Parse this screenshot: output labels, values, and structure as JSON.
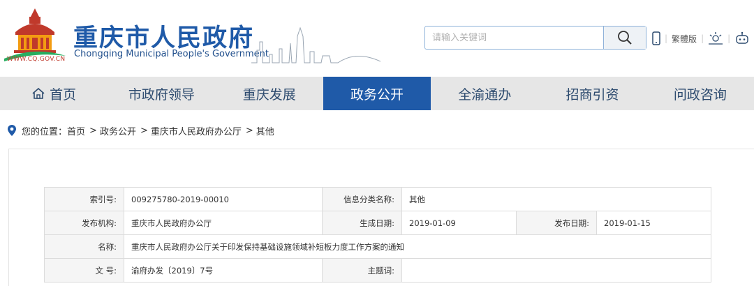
{
  "header": {
    "site_title": "重庆市人民政府",
    "site_subtitle": "Chongqing Municipal People's Government",
    "site_url": "WWW.CQ.GOV.CN",
    "search": {
      "placeholder": "请输入关键词",
      "icon": "search-icon"
    },
    "tools": {
      "traditional": "繁體版",
      "mobile_icon": "mobile-icon",
      "elder_icon": "elder-mode-icon",
      "robot_icon": "robot-icon"
    },
    "colors": {
      "brand_blue": "#1f5aa8",
      "logo_red": "#c0392b",
      "logo_orange": "#f39c12",
      "logo_green": "#27ae60"
    }
  },
  "nav": {
    "items": [
      {
        "label": "首页",
        "active": false
      },
      {
        "label": "市政府领导",
        "active": false
      },
      {
        "label": "重庆发展",
        "active": false
      },
      {
        "label": "政务公开",
        "active": true
      },
      {
        "label": "全渝通办",
        "active": false
      },
      {
        "label": "招商引资",
        "active": false
      },
      {
        "label": "问政咨询",
        "active": false
      }
    ]
  },
  "breadcrumb": {
    "prefix": "您的位置：",
    "items": [
      "首页",
      "政务公开",
      "重庆市人民政府办公厅",
      "其他"
    ]
  },
  "info_table": {
    "index_no": {
      "label": "索引号:",
      "value": "009275780-2019-00010"
    },
    "category": {
      "label": "信息分类名称:",
      "value": "其他"
    },
    "publisher": {
      "label": "发布机构:",
      "value": "重庆市人民政府办公厅"
    },
    "created": {
      "label": "生成日期:",
      "value": "2019-01-09"
    },
    "published": {
      "label": "发布日期:",
      "value": "2019-01-15"
    },
    "name": {
      "label": "名称:",
      "value": "重庆市人民政府办公厅关于印发保持基础设施领域补短板力度工作方案的通知"
    },
    "doc_no": {
      "label": "文 号:",
      "value": "渝府办发〔2019〕7号"
    },
    "keywords": {
      "label": "主题词:",
      "value": ""
    }
  }
}
